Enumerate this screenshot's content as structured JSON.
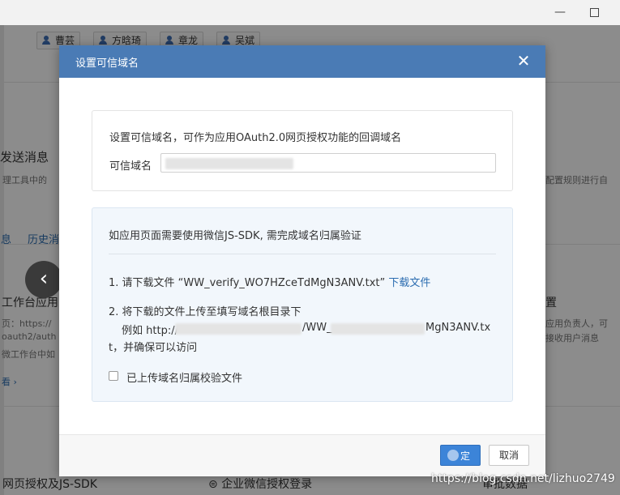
{
  "window": {
    "minimize_glyph": "—",
    "maximize_icon": "maximize-icon"
  },
  "background": {
    "member_chips": [
      "曹芸",
      "方晗琦",
      "章龙",
      "吴斌"
    ],
    "left_texts": {
      "send_message": "发送消息",
      "tool_text": "理工具中的",
      "tab1": "息",
      "tab2": "历史消",
      "workbench": "工作台应用",
      "page_label": "页：https://",
      "oauth": "oauth2/auth",
      "wechat_workbench": "微工作台中如",
      "arrow_link": "看 ›",
      "bottom_left": "网页授权及JS-SDK"
    },
    "right_texts": {
      "config_rule": "配置规则进行自",
      "heading_r": "置",
      "resp1": "应用负责人，可",
      "resp2": "接收用户消息"
    },
    "bottom_middle": "企业微信授权登录",
    "bottom_right": "审批数据"
  },
  "dialog": {
    "title": "设置可信域名",
    "close_glyph": "✕",
    "domain_panel": {
      "description": "设置可信域名，可作为应用OAuth2.0网页授权功能的回调域名",
      "label": "可信域名",
      "input_value": ""
    },
    "verify_panel": {
      "title": "如应用页面需要使用微信JS-SDK, 需完成域名归属验证",
      "step1_prefix": "1. 请下载文件 “WW_verify_WO7HZceTdMgN3ANV.txt”",
      "step1_link": "下载文件",
      "step2": "2. 将下载的文件上传至填写域名根目录下",
      "example_prefix": "例如 http://",
      "example_mid": "/WW_",
      "example_end": "MgN3ANV.tx",
      "example_cont": "t，并确保可以访问",
      "checkbox_label": "已上传域名归属校验文件",
      "checkbox_checked": false
    },
    "footer": {
      "ok_label": "定",
      "cancel_label": "取消"
    }
  },
  "watermark": "https://blog.csdn.net/lizhuo2749",
  "colors": {
    "header_blue": "#4a7bb5",
    "primary_button": "#3c84d8",
    "link": "#2b6cb0",
    "verify_panel_bg": "#f2f7fc"
  }
}
